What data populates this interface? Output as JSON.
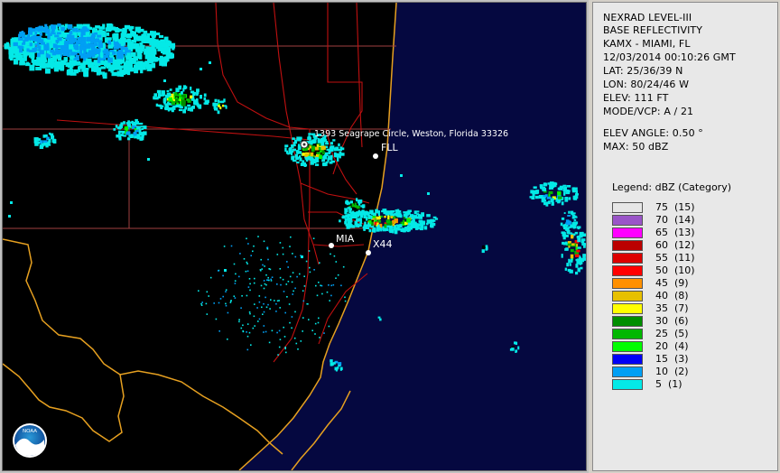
{
  "info": {
    "lines": [
      "NEXRAD LEVEL-III",
      "BASE REFLECTIVITY",
      "KAMX - MIAMI, FL",
      "12/03/2014 00:10:26 GMT",
      "LAT: 25/36/39 N",
      "LON: 80/24/46 W",
      "ELEV: 111 FT",
      "MODE/VCP: A / 21"
    ],
    "elev_angle": "ELEV ANGLE: 0.50 °",
    "max": "MAX: 50 dBZ"
  },
  "legend": {
    "title": "Legend: dBZ (Category)",
    "items": [
      {
        "label": "75  (15)",
        "color": "#e6e6e6"
      },
      {
        "label": "70  (14)",
        "color": "#9a55c8"
      },
      {
        "label": "65  (13)",
        "color": "#ff00ff"
      },
      {
        "label": "60  (12)",
        "color": "#bb0000"
      },
      {
        "label": "55  (11)",
        "color": "#dd0000"
      },
      {
        "label": "50  (10)",
        "color": "#ff0000"
      },
      {
        "label": "45  (9)",
        "color": "#ff9000"
      },
      {
        "label": "40  (8)",
        "color": "#e7c000"
      },
      {
        "label": "35  (7)",
        "color": "#ffff00"
      },
      {
        "label": "30  (6)",
        "color": "#008e00"
      },
      {
        "label": "25  (5)",
        "color": "#01b701"
      },
      {
        "label": "20  (4)",
        "color": "#02fd02"
      },
      {
        "label": "15  (3)",
        "color": "#0000f6"
      },
      {
        "label": "10  (2)",
        "color": "#019ff4"
      },
      {
        "label": "5  (1)",
        "color": "#04e9e7"
      }
    ]
  },
  "map": {
    "location_label": "1393 Seagrape Circle, Weston, Florida 33326",
    "airports": [
      "FLL",
      "MIA",
      "X44"
    ],
    "logo_text": "NOAA",
    "colors": {
      "ocean": "#050840",
      "land": "#000000",
      "coast": "#e6a020",
      "roads": "#c41414",
      "counties": "#b04848"
    }
  }
}
